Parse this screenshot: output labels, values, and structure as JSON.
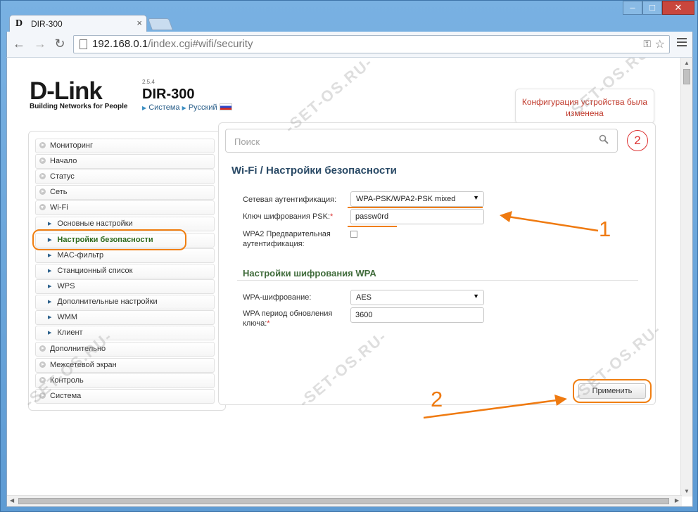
{
  "browser": {
    "tab_title": "DIR-300",
    "tab_close": "×",
    "favicon": "D",
    "url_host": "192.168.0.1",
    "url_path": "/index.cgi#wifi/security",
    "window_buttons": {
      "min": "‒",
      "max": "□",
      "close": "✕"
    }
  },
  "header": {
    "brand": "D-Link",
    "tagline": "Building Networks for People",
    "version": "2.5.4",
    "model": "DIR-300",
    "link_system": "Система",
    "link_language": "Русский"
  },
  "notice": {
    "text": "Конфигурация устройства была изменена"
  },
  "search": {
    "placeholder": "Поиск"
  },
  "badge_number": "2",
  "sidebar": {
    "items": [
      {
        "label": "Мониторинг"
      },
      {
        "label": "Начало"
      },
      {
        "label": "Статус"
      },
      {
        "label": "Сеть"
      },
      {
        "label": "Wi-Fi"
      },
      {
        "label": "Основные настройки"
      },
      {
        "label": "Настройки безопасности"
      },
      {
        "label": "MAC-фильтр"
      },
      {
        "label": "Станционный список"
      },
      {
        "label": "WPS"
      },
      {
        "label": "Дополнительные настройки"
      },
      {
        "label": "WMM"
      },
      {
        "label": "Клиент"
      },
      {
        "label": "Дополнительно"
      },
      {
        "label": "Межсетевой экран"
      },
      {
        "label": "Контроль"
      },
      {
        "label": "Система"
      }
    ]
  },
  "main": {
    "title": "Wi-Fi /  Настройки безопасности",
    "auth_label": "Сетевая аутентификация:",
    "auth_value": "WPA-PSK/WPA2-PSK mixed",
    "psk_label": "Ключ шифрования PSK:",
    "psk_value": "passw0rd",
    "preauth_label_1": "WPA2 Предварительная",
    "preauth_label_2": "аутентификация:",
    "section_title": "Настройки шифрования WPA",
    "enc_label": "WPA-шифрование:",
    "enc_value": "AES",
    "period_label_1": "WPA период обновления",
    "period_label_2": "ключа:",
    "period_value": "3600",
    "apply_label": "Применить",
    "required_mark": "*"
  },
  "annotations": {
    "one": "1",
    "two": "2"
  },
  "watermark": "-SET-OS.RU-",
  "colors": {
    "accent_orange": "#f07f12",
    "notice_red": "#c0392b",
    "title_blue": "#2a4a66",
    "section_green": "#3f6b3a"
  }
}
